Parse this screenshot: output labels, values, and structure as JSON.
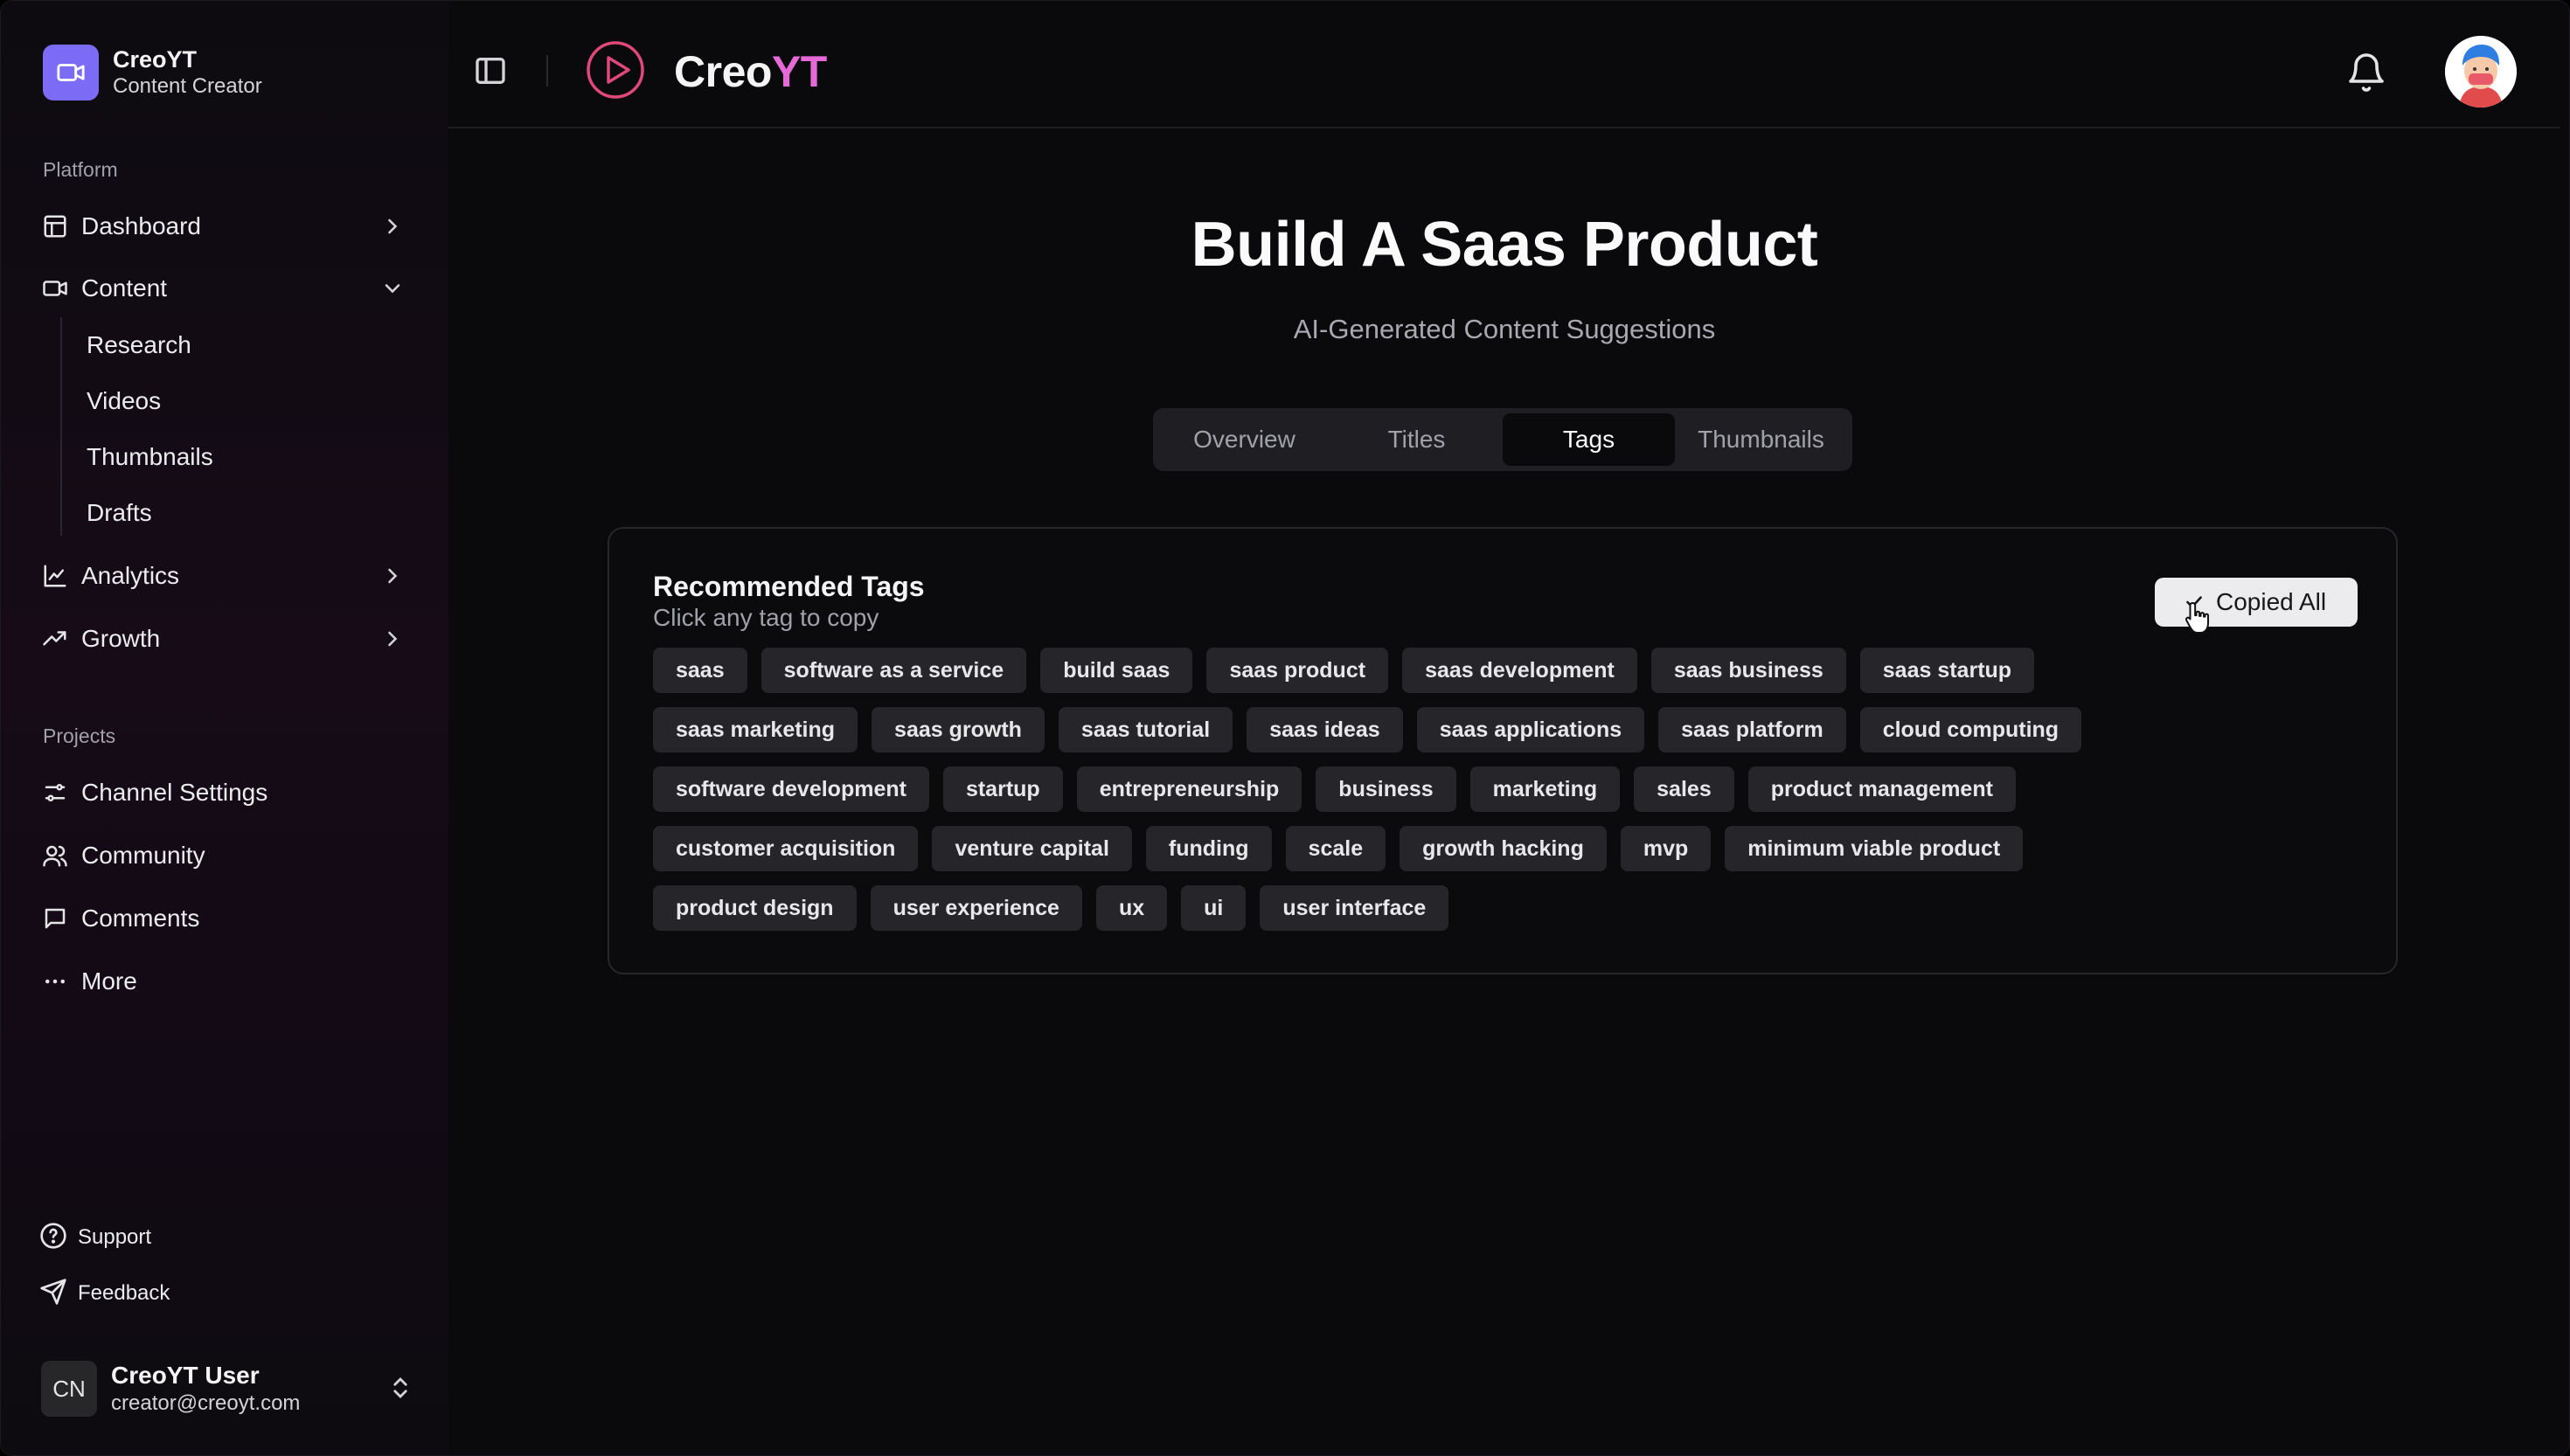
{
  "brand": {
    "name": "CreoYT",
    "subtitle": "Content Creator"
  },
  "sidebar": {
    "platform_label": "Platform",
    "dashboard": "Dashboard",
    "content": "Content",
    "content_children": [
      "Research",
      "Videos",
      "Thumbnails",
      "Drafts"
    ],
    "analytics": "Analytics",
    "growth": "Growth",
    "projects_label": "Projects",
    "projects": [
      "Channel Settings",
      "Community",
      "Comments",
      "More"
    ],
    "support": "Support",
    "feedback": "Feedback"
  },
  "user": {
    "initials": "CN",
    "name": "CreoYT User",
    "email": "creator@creoyt.com"
  },
  "header": {
    "logo_prefix": "Creo",
    "logo_suffix": "YT"
  },
  "main": {
    "title": "Build A Saas Product",
    "subtitle": "AI-Generated Content Suggestions",
    "tabs": [
      {
        "label": "Overview",
        "active": false
      },
      {
        "label": "Titles",
        "active": false
      },
      {
        "label": "Tags",
        "active": true
      },
      {
        "label": "Thumbnails",
        "active": false
      }
    ]
  },
  "card": {
    "title": "Recommended Tags",
    "subtitle": "Click any tag to copy",
    "copy_button": "Copied All",
    "tag_rows": [
      [
        "saas",
        "software as a service",
        "build saas",
        "saas product",
        "saas development",
        "saas business",
        "saas startup"
      ],
      [
        "saas marketing",
        "saas growth",
        "saas tutorial",
        "saas ideas",
        "saas applications",
        "saas platform",
        "cloud computing"
      ],
      [
        "software development",
        "startup",
        "entrepreneurship",
        "business",
        "marketing",
        "sales",
        "product management"
      ],
      [
        "customer acquisition",
        "venture capital",
        "funding",
        "scale",
        "growth hacking",
        "mvp",
        "minimum viable product"
      ],
      [
        "product design",
        "user experience",
        "ux",
        "ui",
        "user interface"
      ]
    ]
  },
  "colors": {
    "accent": "#7c6cf5",
    "logo_pink": "#e56ad8",
    "background": "#0a090c"
  }
}
